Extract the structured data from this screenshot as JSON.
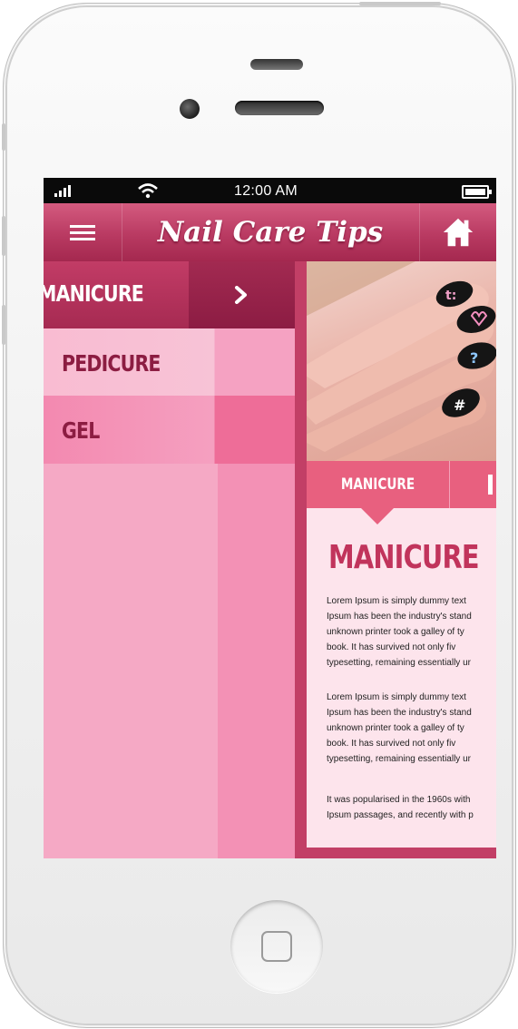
{
  "statusbar": {
    "time": "12:00 AM"
  },
  "header": {
    "title": "Nail Care Tips"
  },
  "drawer": {
    "items": [
      {
        "label": "MANICURE",
        "active": true
      },
      {
        "label": "PEDICURE"
      },
      {
        "label": "GEL"
      }
    ]
  },
  "content": {
    "tabs": [
      {
        "label": "MANICURE"
      }
    ],
    "heading": "MANICURE",
    "paragraph1": [
      "Lorem Ipsum is simply dummy text",
      "Ipsum has been the industry's stand",
      "unknown printer took a galley of ty",
      "book. It has survived not only fiv",
      "typesetting, remaining essentially ur"
    ],
    "paragraph2": [
      "Lorem Ipsum is simply dummy text",
      "Ipsum has been the industry's stand",
      "unknown printer took a galley of ty",
      "book. It has survived not only fiv",
      "typesetting, remaining essentially ur"
    ],
    "paragraph3": [
      "It was popularised in the 1960s with",
      "Ipsum passages, and recently with p"
    ]
  },
  "colors": {
    "brand": "#b93a62",
    "drawer_pink": "#f5a9c5",
    "accent_tab": "#e8607f",
    "heading": "#c1345c"
  },
  "icons": [
    "signal-icon",
    "wifi-icon",
    "battery-icon",
    "menu-icon",
    "home-icon",
    "chevron-right-icon"
  ]
}
